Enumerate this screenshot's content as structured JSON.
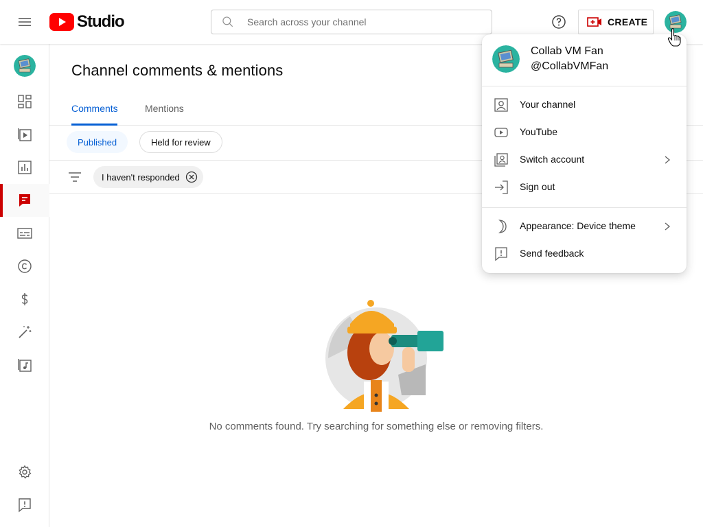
{
  "app": {
    "logo_text": "Studio"
  },
  "header": {
    "search_placeholder": "Search across your channel",
    "create_label": "CREATE"
  },
  "page": {
    "title": "Channel comments & mentions",
    "tabs": [
      {
        "label": "Comments",
        "active": true
      },
      {
        "label": "Mentions",
        "active": false
      }
    ],
    "subtabs": [
      {
        "label": "Published",
        "active": true
      },
      {
        "label": "Held for review",
        "active": false
      }
    ],
    "filter_chip": "I haven't responded",
    "empty_message": "No comments found. Try searching for something else or removing filters."
  },
  "sidebar": {
    "items": [
      {
        "icon": "dashboard-icon"
      },
      {
        "icon": "content-icon"
      },
      {
        "icon": "analytics-icon"
      },
      {
        "icon": "comments-icon",
        "active": true
      },
      {
        "icon": "subtitles-icon"
      },
      {
        "icon": "copyright-icon"
      },
      {
        "icon": "earn-icon"
      },
      {
        "icon": "customization-icon"
      },
      {
        "icon": "audio-library-icon"
      }
    ],
    "bottom_items": [
      {
        "icon": "settings-icon"
      },
      {
        "icon": "feedback-icon"
      }
    ]
  },
  "account_menu": {
    "name": "Collab VM Fan",
    "handle": "@CollabVMFan",
    "items": [
      {
        "label": "Your channel",
        "icon": "person-icon"
      },
      {
        "label": "YouTube",
        "icon": "youtube-icon"
      },
      {
        "label": "Switch account",
        "icon": "switch-account-icon",
        "has_submenu": true
      },
      {
        "label": "Sign out",
        "icon": "sign-out-icon"
      },
      {
        "label": "Appearance: Device theme",
        "icon": "moon-icon",
        "has_submenu": true
      },
      {
        "label": "Send feedback",
        "icon": "feedback-icon"
      }
    ]
  },
  "colors": {
    "brand_red": "#ff0000",
    "accent_blue": "#065fd4",
    "active_red": "#cc0000",
    "avatar_teal": "#2bb3a0"
  }
}
